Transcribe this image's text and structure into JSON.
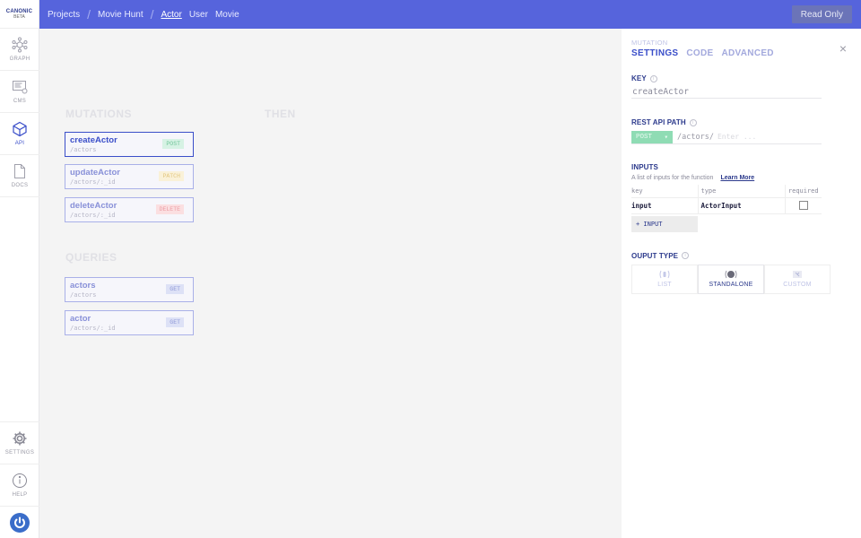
{
  "brand": {
    "line1": "CANONIC",
    "line2": "BETA"
  },
  "sidebar": {
    "top": [
      {
        "label": "GRAPH",
        "icon": "graph-icon"
      },
      {
        "label": "CMS",
        "icon": "cms-icon"
      },
      {
        "label": "API",
        "icon": "api-icon",
        "active": true
      },
      {
        "label": "DOCS",
        "icon": "docs-icon"
      }
    ],
    "bottom": [
      {
        "label": "SETTINGS",
        "icon": "gear-icon"
      },
      {
        "label": "HELP",
        "icon": "help-icon"
      }
    ]
  },
  "header": {
    "crumbs": [
      "Projects",
      "Movie Hunt",
      "Actor",
      "User",
      "Movie"
    ],
    "readonly": "Read Only"
  },
  "canvas": {
    "mutations_title": "MUTATIONS",
    "then_title": "THEN",
    "queries_title": "QUERIES",
    "mutations": [
      {
        "name": "createActor",
        "path": "/actors",
        "method": "POST"
      },
      {
        "name": "updateActor",
        "path": "/actors/:_id",
        "method": "PATCH"
      },
      {
        "name": "deleteActor",
        "path": "/actors/:_id",
        "method": "DELETE"
      }
    ],
    "queries": [
      {
        "name": "actors",
        "path": "/actors",
        "method": "GET"
      },
      {
        "name": "actor",
        "path": "/actors/:_id",
        "method": "GET"
      }
    ]
  },
  "panel": {
    "subtitle": "MUTATION",
    "tabs": [
      "SETTINGS",
      "CODE",
      "ADVANCED"
    ],
    "key_label": "KEY",
    "key_value": "createActor",
    "rest_label": "REST API PATH",
    "rest_method": "POST",
    "rest_prefix": "/actors/",
    "rest_placeholder": "Enter ...",
    "inputs_label": "INPUTS",
    "inputs_desc": "A list of inputs for the function",
    "learn_more": "Learn More",
    "table_headers": [
      "key",
      "type",
      "required"
    ],
    "table_rows": [
      {
        "key": "input",
        "type": "ActorInput"
      }
    ],
    "add_input": "+ INPUT",
    "output_label": "OUPUT TYPE",
    "output_types": [
      "LIST",
      "STANDALONE",
      "CUSTOM"
    ],
    "info_glyph": "i",
    "close_glyph": "×",
    "dropdown_glyph": "▾"
  }
}
